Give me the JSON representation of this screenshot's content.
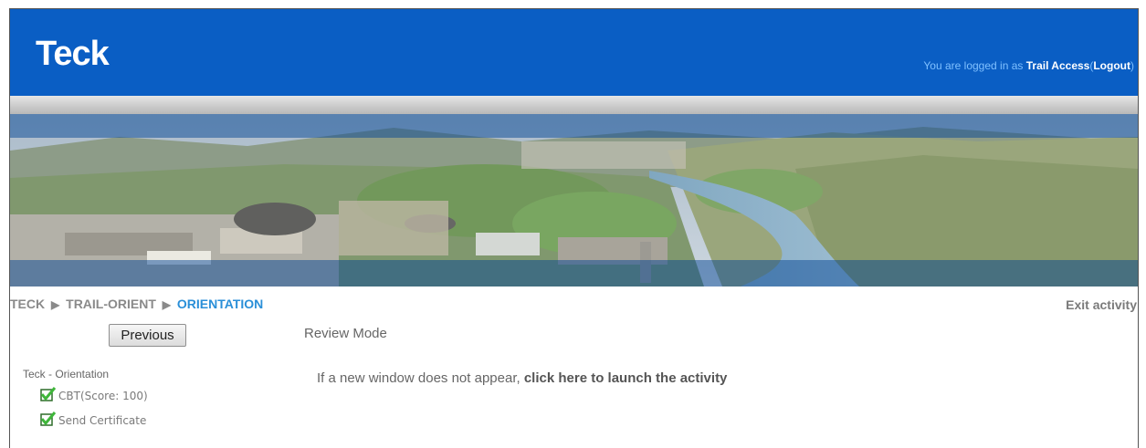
{
  "header": {
    "logo": "Teck",
    "login_prefix": "You are logged in as",
    "user": "Trail Access",
    "logout_open": "(",
    "logout_label": "Logout",
    "logout_close": ")"
  },
  "breadcrumb": {
    "items": [
      "TECK",
      "TRAIL-ORIENT",
      "ORIENTATION"
    ],
    "separator": "▶"
  },
  "exit_label": "Exit activity",
  "previous_label": "Previous",
  "review_mode": "Review Mode",
  "toc": {
    "title": "Teck - Orientation",
    "items": [
      {
        "label": "CBT(Score: 100)",
        "status": "completed"
      },
      {
        "label": "Send Certificate",
        "status": "completed"
      }
    ]
  },
  "launch": {
    "prefix": "If a new window does not appear,",
    "link_label": "click here to launch the activity"
  },
  "colors": {
    "header_bg": "#0a5ec4",
    "breadcrumb_current": "#2a8fd8",
    "check_green": "#3fb63a"
  }
}
